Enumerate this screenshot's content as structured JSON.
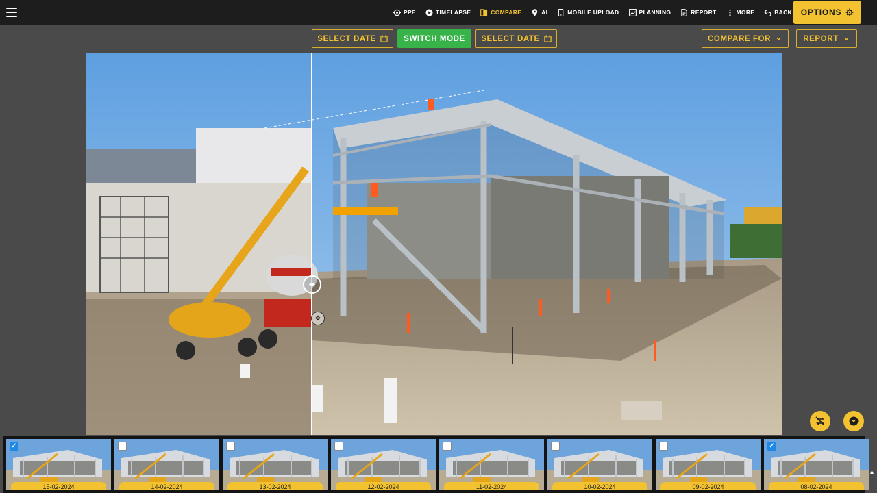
{
  "nav": {
    "items": [
      {
        "label": "PPE",
        "icon": "target-icon",
        "active": false
      },
      {
        "label": "TIMELAPSE",
        "icon": "play-circle-icon",
        "active": false
      },
      {
        "label": "COMPARE",
        "icon": "compare-icon",
        "active": true
      },
      {
        "label": "AI",
        "icon": "location-pin-icon",
        "active": false
      },
      {
        "label": "MOBILE UPLOAD",
        "icon": "phone-icon",
        "active": false
      },
      {
        "label": "PLANNING",
        "icon": "chart-icon",
        "active": false
      },
      {
        "label": "REPORT",
        "icon": "document-icon",
        "active": false
      },
      {
        "label": "MORE",
        "icon": "dots-vertical-icon",
        "active": false
      },
      {
        "label": "BACK",
        "icon": "undo-icon",
        "active": false
      }
    ],
    "options_label": "OPTIONS"
  },
  "toolbar": {
    "select_date_left": "SELECT DATE",
    "switch_mode": "SWITCH MODE",
    "select_date_right": "SELECT DATE",
    "compare_for": "COMPARE FOR",
    "report": "REPORT"
  },
  "thumbnails": [
    {
      "date": "15-02-2024",
      "checked": true
    },
    {
      "date": "14-02-2024",
      "checked": false
    },
    {
      "date": "13-02-2024",
      "checked": false
    },
    {
      "date": "12-02-2024",
      "checked": false
    },
    {
      "date": "11-02-2024",
      "checked": false
    },
    {
      "date": "10-02-2024",
      "checked": false
    },
    {
      "date": "09-02-2024",
      "checked": false
    },
    {
      "date": "08-02-2024",
      "checked": true
    }
  ],
  "colors": {
    "accent": "#f2c230",
    "switch_mode": "#37b34a",
    "nav_bg": "#1d1d1d",
    "checkbox": "#1e88e5"
  }
}
